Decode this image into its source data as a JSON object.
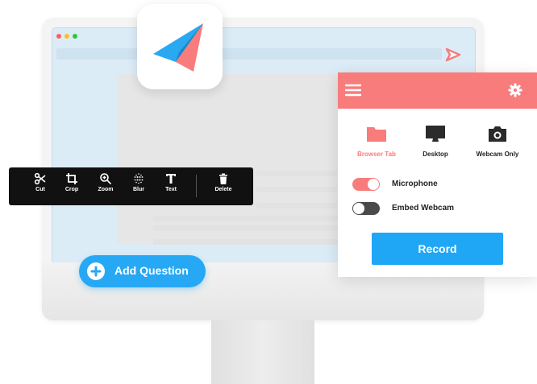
{
  "toolbar": {
    "tools": [
      {
        "label": "Cut",
        "icon": "scissors-icon"
      },
      {
        "label": "Crop",
        "icon": "crop-icon"
      },
      {
        "label": "Zoom",
        "icon": "zoom-icon"
      },
      {
        "label": "Blur",
        "icon": "blur-icon"
      },
      {
        "label": "Text",
        "icon": "text-icon"
      },
      {
        "label": "Delete",
        "icon": "trash-icon"
      }
    ]
  },
  "add_question": {
    "label": "Add Question",
    "icon": "plus-icon"
  },
  "recorder": {
    "menu_icon": "hamburger-icon",
    "settings_icon": "gear-icon",
    "modes": [
      {
        "label": "Browser Tab",
        "icon": "folder-icon",
        "selected": true
      },
      {
        "label": "Desktop",
        "icon": "monitor-icon",
        "selected": false
      },
      {
        "label": "Webcam Only",
        "icon": "camera-icon",
        "selected": false
      }
    ],
    "toggles": [
      {
        "label": "Microphone",
        "on": true
      },
      {
        "label": "Embed Webcam",
        "on": false
      }
    ],
    "record_label": "Record"
  },
  "colors": {
    "accent_red": "#f87c7c",
    "accent_blue": "#27a8f5",
    "toolbar_bg": "#111111"
  }
}
